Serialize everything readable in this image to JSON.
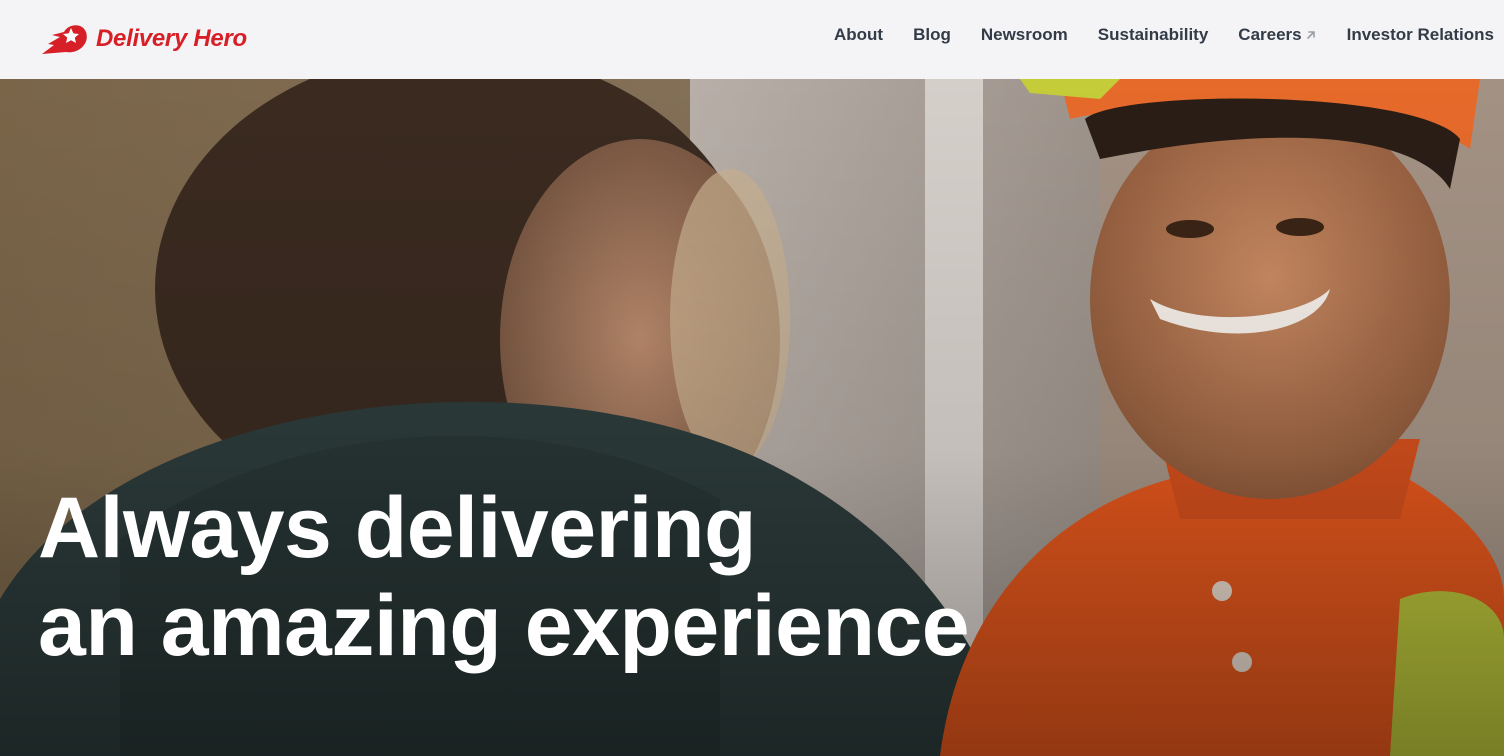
{
  "brand": {
    "name": "Delivery Hero",
    "color": "#d61f26",
    "logo_icon": "delivery-hero-star-logo"
  },
  "nav": {
    "items": [
      {
        "label": "About"
      },
      {
        "label": "Blog"
      },
      {
        "label": "Newsroom"
      },
      {
        "label": "Sustainability"
      },
      {
        "label": "Careers",
        "icon": "external-arrow-icon"
      },
      {
        "label": "Investor Relations"
      }
    ]
  },
  "hero": {
    "headline_line1": "Always delivering",
    "headline_line2": "an amazing experience",
    "image": "delivery-rider-handing-over-order"
  }
}
